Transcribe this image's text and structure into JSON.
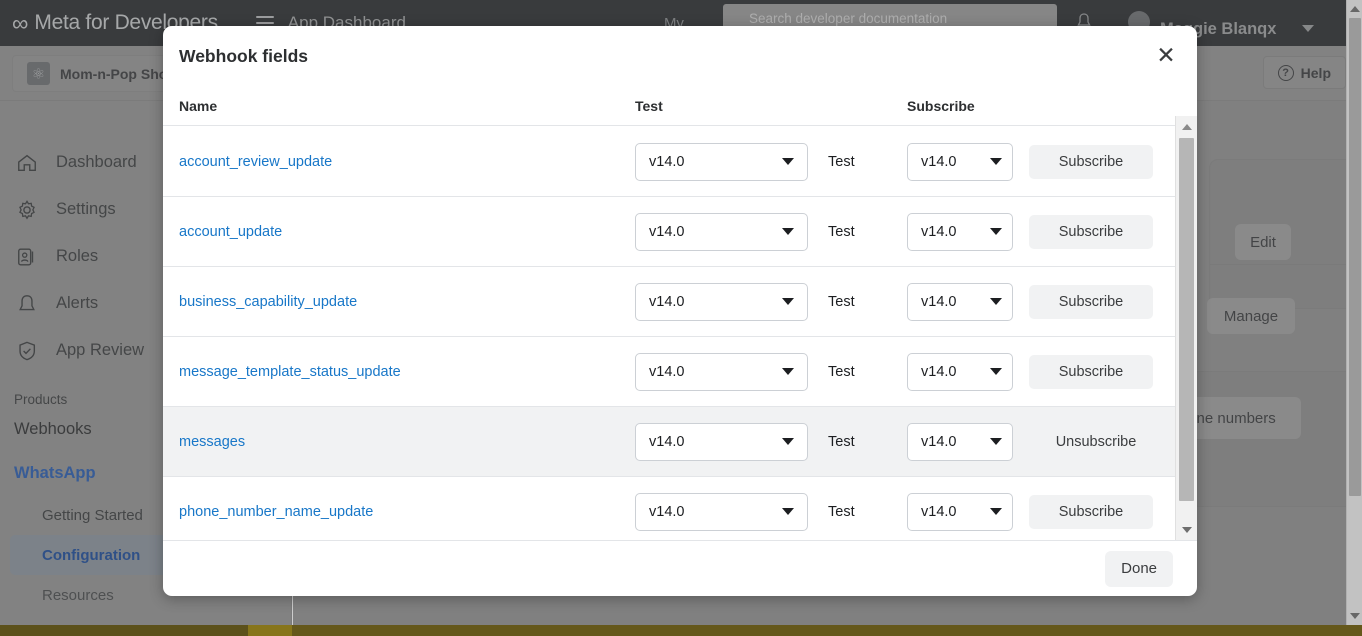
{
  "topbar": {
    "brand": "Meta for Developers",
    "infinity_icon": "infinity-icon",
    "menu_icon": "hamburger-icon",
    "app_dashboard": "App Dashboard",
    "my_label": "My",
    "search_placeholder": "Search developer documentation",
    "bell_icon": "bell-icon",
    "username": "Maggie Blanqx",
    "caret_icon": "chevron-down-icon"
  },
  "appbar": {
    "app_name": "Mom-n-Pop Shop",
    "app_icon": "app-atom-icon",
    "help_label": "Help",
    "help_icon": "question-circle-icon"
  },
  "sidebar": {
    "items": [
      {
        "label": "Dashboard",
        "icon": "home-icon"
      },
      {
        "label": "Settings",
        "icon": "gear-icon"
      },
      {
        "label": "Roles",
        "icon": "roles-icon"
      },
      {
        "label": "Alerts",
        "icon": "bell-icon"
      },
      {
        "label": "App Review",
        "icon": "shield-check-icon"
      }
    ],
    "products_label": "Products",
    "webhooks_label": "Webhooks",
    "whatsapp_label": "WhatsApp",
    "sub_items": [
      {
        "label": "Getting Started",
        "active": false
      },
      {
        "label": "Configuration",
        "active": true
      },
      {
        "label": "Resources",
        "active": false
      }
    ]
  },
  "background": {
    "edit_label": "Edit",
    "manage_label": "Manage",
    "phone_numbers_label": "one numbers"
  },
  "modal": {
    "title": "Webhook fields",
    "close_icon": "close-icon",
    "columns": {
      "name": "Name",
      "test": "Test",
      "subscribe": "Subscribe"
    },
    "test_link_label": "Test",
    "subscribe_label": "Subscribe",
    "unsubscribe_label": "Unsubscribe",
    "version_value": "v14.0",
    "done_label": "Done",
    "rows": [
      {
        "name": "account_review_update",
        "test_version": "v14.0",
        "sub_version": "v14.0",
        "action": "Subscribe",
        "subscribed": false
      },
      {
        "name": "account_update",
        "test_version": "v14.0",
        "sub_version": "v14.0",
        "action": "Subscribe",
        "subscribed": false
      },
      {
        "name": "business_capability_update",
        "test_version": "v14.0",
        "sub_version": "v14.0",
        "action": "Subscribe",
        "subscribed": false
      },
      {
        "name": "message_template_status_update",
        "test_version": "v14.0",
        "sub_version": "v14.0",
        "action": "Subscribe",
        "subscribed": false
      },
      {
        "name": "messages",
        "test_version": "v14.0",
        "sub_version": "v14.0",
        "action": "Unsubscribe",
        "subscribed": true
      },
      {
        "name": "phone_number_name_update",
        "test_version": "v14.0",
        "sub_version": "v14.0",
        "action": "Subscribe",
        "subscribed": false
      }
    ]
  },
  "colors": {
    "link_blue": "#1877c8",
    "brand_blue": "#2a5db0",
    "topbar_dark": "#2b2e31",
    "scrim_gray": "#949494",
    "row_highlight": "#f1f2f3",
    "bottom_strip": "#6b5800"
  }
}
